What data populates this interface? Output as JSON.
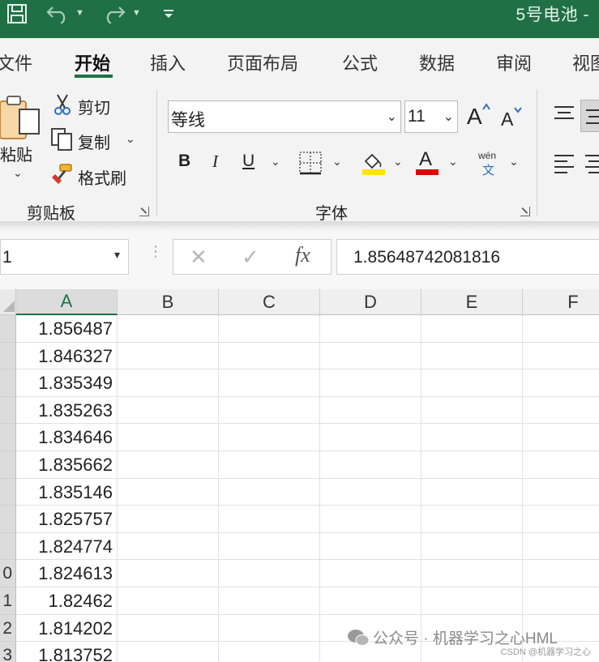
{
  "quick_access": {
    "save_icon": "save-icon",
    "undo_icon": "undo-icon",
    "redo_icon": "redo-icon",
    "customize_icon": "customize-toolbar-icon"
  },
  "title": "5号电池 -",
  "ribbon_tabs": [
    "文件",
    "开始",
    "插入",
    "页面布局",
    "公式",
    "数据",
    "审阅",
    "视图"
  ],
  "active_tab": "开始",
  "clipboard": {
    "paste": "粘贴",
    "cut": "剪切",
    "copy": "复制",
    "format_painter": "格式刷",
    "group_label": "剪贴板"
  },
  "font": {
    "name": "等线",
    "size": "11",
    "bold": "B",
    "italic": "I",
    "underline": "U",
    "font_color_glyph": "A",
    "wen_top": "wén",
    "wen_bottom": "文",
    "group_label": "字体",
    "highlight_color": "#ffe400",
    "font_color": "#e00000"
  },
  "formula_bar": {
    "name_box": "1",
    "formula": "1.85648742081816"
  },
  "columns": [
    "A",
    "B",
    "C",
    "D",
    "E",
    "F"
  ],
  "rows": [
    {
      "num": "",
      "value": "1.856487"
    },
    {
      "num": "",
      "value": "1.846327"
    },
    {
      "num": "",
      "value": "1.835349"
    },
    {
      "num": "",
      "value": "1.835263"
    },
    {
      "num": "",
      "value": "1.834646"
    },
    {
      "num": "",
      "value": "1.835662"
    },
    {
      "num": "",
      "value": "1.835146"
    },
    {
      "num": "",
      "value": "1.825757"
    },
    {
      "num": "",
      "value": "1.824774"
    },
    {
      "num": "0",
      "value": "1.824613"
    },
    {
      "num": "1",
      "value": "1.82462"
    },
    {
      "num": "2",
      "value": "1.814202"
    },
    {
      "num": "3",
      "value": "1.813752"
    }
  ],
  "watermark": "公众号 · 机器学习之心HML",
  "csdn": "CSDN @机器学习之心",
  "accent_color": "#1f7145"
}
